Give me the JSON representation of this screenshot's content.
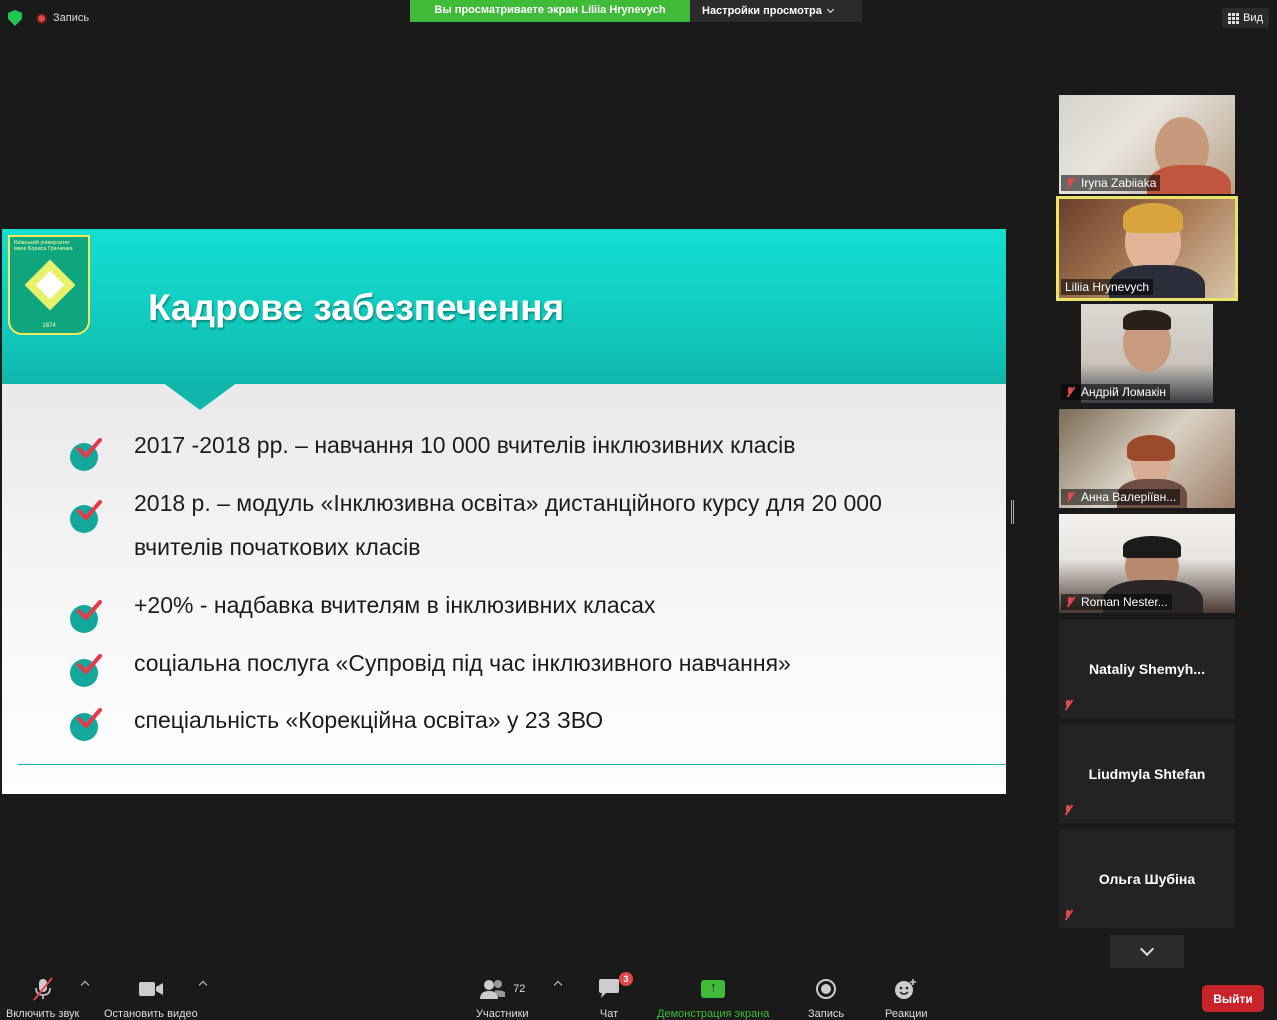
{
  "topbar": {
    "recording_label": "Запись",
    "share_banner": "Вы просматриваете экран Liliia Hrynevych",
    "view_settings": "Настройки просмотра",
    "view_button": "Вид"
  },
  "slide": {
    "logo_text_line1": "Київський університет",
    "logo_text_line2": "імені Бориса Грінченка",
    "logo_year": "1874",
    "title": "Кадрове забезпечення",
    "bullets": [
      "2017 -2018 рр. – навчання 10 000 вчителів інклюзивних класів",
      "2018 р. – модуль «Інклюзивна освіта» дистанційного  курсу для 20 000",
      "вчителів початкових класів",
      "+20% - надбавка вчителям в інклюзивних класах",
      "соціальна послуга «Супровід під час інклюзивного навчання»",
      "спеціальність «Корекційна освіта» у 23 ЗВО"
    ]
  },
  "participants": [
    {
      "name": "Iryna Zabiiaka",
      "muted": true,
      "video": true
    },
    {
      "name": "Liliia Hrynevych",
      "muted": false,
      "video": true,
      "active_speaker": true
    },
    {
      "name": "Андрій Ломакін",
      "muted": true,
      "video": true
    },
    {
      "name": "Анна Валеріївн...",
      "muted": true,
      "video": true
    },
    {
      "name": "Roman Nester...",
      "muted": true,
      "video": true
    },
    {
      "name": "Nataliy  Shemyh...",
      "muted": true,
      "video": false
    },
    {
      "name": "Liudmyla Shtefan",
      "muted": true,
      "video": false
    },
    {
      "name": "Ольга Шубіна",
      "muted": true,
      "video": false
    }
  ],
  "toolbar": {
    "unmute_label": "Включить звук",
    "stop_video_label": "Остановить видео",
    "participants_label": "Участники",
    "participants_count": "72",
    "chat_label": "Чат",
    "chat_badge": "3",
    "share_label": "Демонстрация экрана",
    "record_label": "Запись",
    "reactions_label": "Реакции",
    "leave_label": "Выйти"
  },
  "colors": {
    "accent_green": "#3fbb39",
    "slide_teal": "#11cbbd",
    "leave_red": "#c8232b",
    "active_speaker_outline": "#eae36a"
  }
}
